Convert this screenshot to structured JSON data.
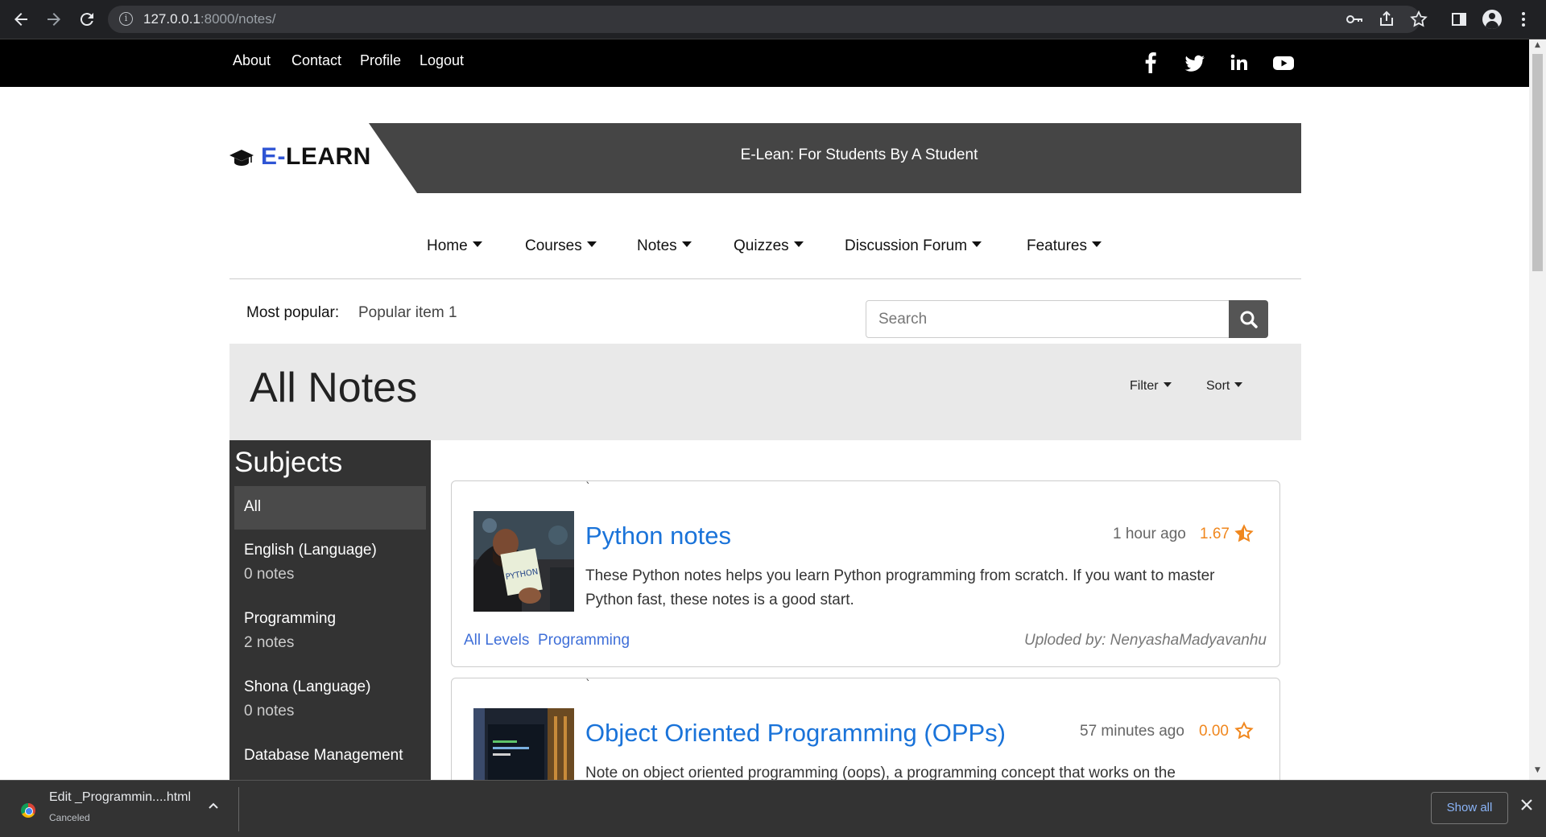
{
  "browser": {
    "url_host": "127.0.0.1",
    "url_rest": ":8000/notes/"
  },
  "topbar": {
    "links": [
      "About",
      "Contact",
      "Profile",
      "Logout"
    ]
  },
  "brand": {
    "logo_prefix": "E-",
    "logo_rest": "LEARN",
    "tagline": "E-Lean: For Students By A Student"
  },
  "mainnav": {
    "items": [
      "Home",
      "Courses",
      "Notes",
      "Quizzes",
      "Discussion Forum",
      "Features"
    ]
  },
  "popular": {
    "label": "Most popular:",
    "item": "Popular item 1"
  },
  "search": {
    "placeholder": "Search"
  },
  "titleband": {
    "title": "All Notes",
    "filter": "Filter",
    "sort": "Sort"
  },
  "sidebar": {
    "heading": "Subjects",
    "subjects": [
      {
        "name": "All",
        "count": ""
      },
      {
        "name": "English (Language)",
        "count": "0 notes"
      },
      {
        "name": "Programming",
        "count": "2 notes"
      },
      {
        "name": "Shona (Language)",
        "count": "0 notes"
      },
      {
        "name": "Database Management",
        "count": ""
      }
    ]
  },
  "notes": [
    {
      "tick": "`",
      "title": "Python notes",
      "time": "1 hour ago",
      "rating": "1.67",
      "description": "These Python notes helps you learn Python programming from scratch. If you want to master Python fast, these notes is a good start.",
      "tags": [
        "All Levels",
        "Programming"
      ],
      "uploader": "Uploded by: NenyashaMadyavanhu",
      "thumb_text": "PYTHON"
    },
    {
      "tick": "`",
      "title": "Object Oriented Programming (OPPs)",
      "time": "57 minutes ago",
      "rating": "0.00",
      "description": "Note on object oriented programming (oops), a programming concept that works on the",
      "tags": [],
      "uploader": ""
    }
  ],
  "download": {
    "filename": "Edit _Programmin....html",
    "status": "Canceled",
    "show_all": "Show all"
  },
  "colors": {
    "accent_blue": "#1a73d9",
    "rating_orange": "#f0871e",
    "band_dark": "#454545",
    "sidebar_bg": "#333333"
  }
}
